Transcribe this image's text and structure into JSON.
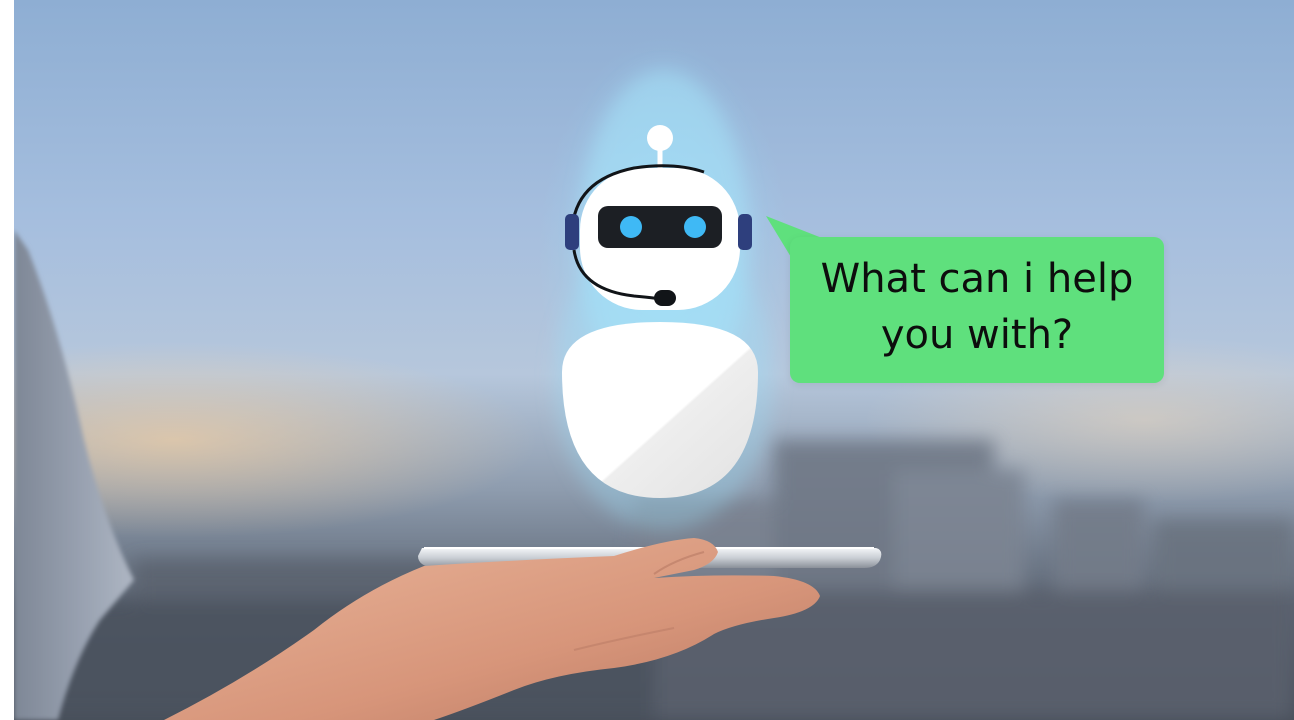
{
  "speech_bubble": {
    "line1": "What can i help",
    "line2": "you with?"
  },
  "colors": {
    "bubble": "#5fe07d",
    "robot_visor": "#1c1f24",
    "robot_eyes": "#3fb9f5",
    "headset_ear": "#2e3f7d",
    "robot_body": "#ffffff"
  },
  "icons": [
    "chatbot-robot-icon",
    "headset-microphone-icon",
    "speech-bubble-icon",
    "smartphone",
    "hand"
  ]
}
